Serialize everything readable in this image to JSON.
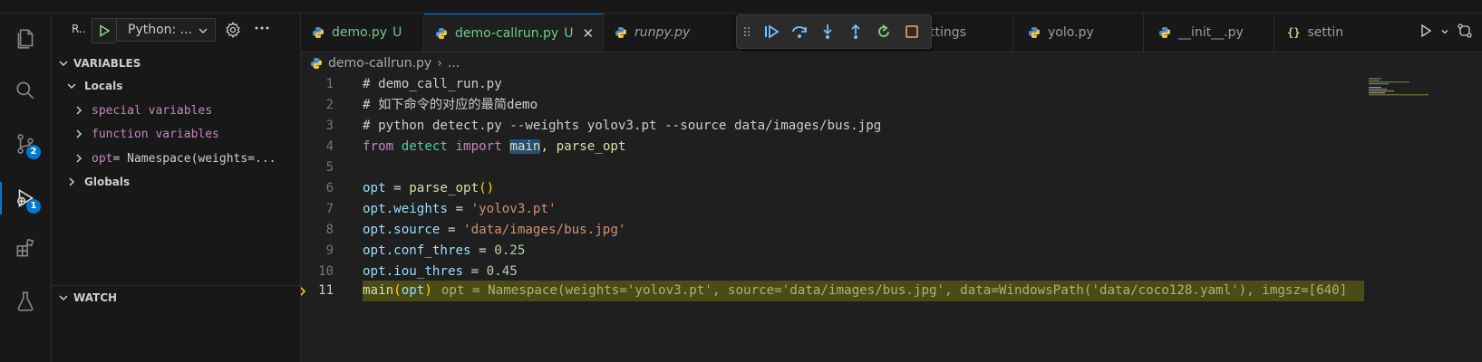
{
  "sidebar": {
    "run_label": "R..",
    "config_select": "Python: ...",
    "sections": {
      "variables": "VARIABLES",
      "locals": "Locals",
      "globals": "Globals",
      "watch": "WATCH"
    },
    "locals_items": [
      {
        "name": "special variables",
        "value": ""
      },
      {
        "name": "function variables",
        "value": ""
      },
      {
        "name": "opt",
        "value": " = Namespace(weights=..."
      }
    ]
  },
  "activity_bar": {
    "items": [
      {
        "icon": "explorer-icon"
      },
      {
        "icon": "search-icon"
      },
      {
        "icon": "source-control-icon",
        "badge": "2"
      },
      {
        "icon": "run-debug-icon",
        "badge": "1"
      },
      {
        "icon": "extensions-icon"
      },
      {
        "icon": "testing-icon"
      }
    ]
  },
  "tabs": [
    {
      "label": "demo.py",
      "suffix": "U"
    },
    {
      "label": "demo-callrun.py",
      "suffix": "U",
      "close": "✕"
    },
    {
      "label": "runpy.py"
    },
    {
      "label": "ttings"
    },
    {
      "label": "yolo.py"
    },
    {
      "label": "__init__.py"
    },
    {
      "label": "settin"
    }
  ],
  "breadcrumb": {
    "file": "demo-callrun.py",
    "separator": "›",
    "rest": "..."
  },
  "editor": {
    "lines": [
      {
        "n": "1",
        "text": "# demo_call_run.py"
      },
      {
        "n": "2",
        "text": "# 如下命令的对应的最简demo"
      },
      {
        "n": "3",
        "text": "# python detect.py --weights yolov3.pt --source data/images/bus.jpg"
      },
      {
        "n": "4",
        "kw1": "from",
        "mod": "detect",
        "kw2": "import",
        "w1": "main",
        "rest": ", parse_opt"
      },
      {
        "n": "5"
      },
      {
        "n": "6",
        "var": "opt",
        "op": " = ",
        "fn": "parse_opt",
        "p": "()"
      },
      {
        "n": "7",
        "var": "opt",
        "attr": ".weights",
        "op": " = ",
        "str": "'yolov3.pt'"
      },
      {
        "n": "8",
        "var": "opt",
        "attr": ".source",
        "op": " = ",
        "str": "'data/images/bus.jpg'"
      },
      {
        "n": "9",
        "var": "opt",
        "attr": ".conf_thres",
        "op": " = ",
        "num": "0.25"
      },
      {
        "n": "10",
        "var": "opt",
        "attr": ".iou_thres",
        "op": " = ",
        "num": "0.45"
      },
      {
        "n": "11",
        "fn": "main",
        "p1": "(",
        "arg": "opt",
        "p2": ")",
        "inline": "opt = Namespace(weights='yolov3.pt', source='data/images/bus.jpg', data=WindowsPath('data/coco128.yaml'), imgsz=[640]"
      }
    ]
  },
  "colors": {
    "accent": "#0078d4",
    "current_line": "#4b4b18",
    "debug_arrow": "#ffcc00"
  }
}
